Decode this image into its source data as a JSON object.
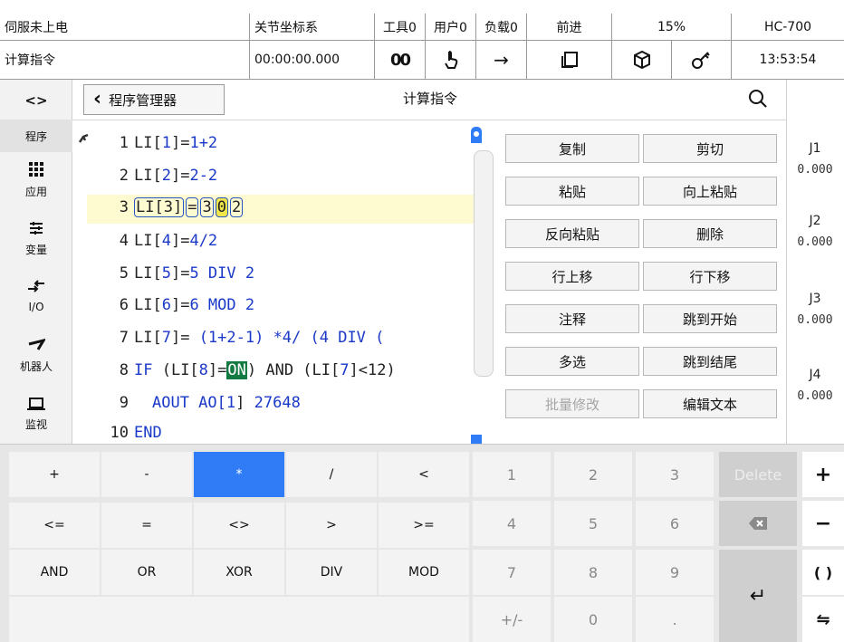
{
  "status": {
    "servo": "伺服未上电",
    "coord": "关节坐标系",
    "tool": "工具0",
    "user": "用户0",
    "load": "负载0",
    "direction": "前进",
    "speed": "15%",
    "model": "HC-700",
    "program_label": "计算指令",
    "elapsed": "00:00:00.000",
    "pause_icon_text": "00",
    "arrow_icon_text": "→",
    "clock": "13:53:54"
  },
  "header": {
    "back_label": "程序管理器",
    "back_chevron": "‹",
    "title": "计算指令"
  },
  "sidebar": {
    "toggle_glyph": "<>",
    "items": [
      {
        "label": "程序",
        "icon": "program-icon"
      },
      {
        "label": "应用",
        "icon": "apps-icon"
      },
      {
        "label": "变量",
        "icon": "variable-icon"
      },
      {
        "label": "I/O",
        "icon": "io-icon"
      },
      {
        "label": "机器人",
        "icon": "robot-icon"
      },
      {
        "label": "监视",
        "icon": "monitor-icon"
      }
    ]
  },
  "code": {
    "l1": {
      "num": "1",
      "a": "LI[",
      "b": "1",
      "c": "]=",
      "d": "1+2"
    },
    "l2": {
      "num": "2",
      "a": "LI[",
      "b": "2",
      "c": "]=",
      "d": "2-2"
    },
    "l3": {
      "num": "3",
      "var": "LI[3]",
      "eq": "=",
      "t1": "3",
      "t2": "0",
      "t3": "2"
    },
    "l4": {
      "num": "4",
      "a": "LI[",
      "b": "4",
      "c": "]=",
      "d": "4/2"
    },
    "l5": {
      "num": "5",
      "a": "LI[",
      "b": "5",
      "c": "]=",
      "d": "5 DIV 2"
    },
    "l6": {
      "num": "6",
      "a": "LI[",
      "b": "6",
      "c": "]=",
      "d": "6 MOD 2"
    },
    "l7": {
      "num": "7",
      "a": "LI[",
      "b": "7",
      "c": "]= ",
      "d": "(1+2-1) *4/ (4 DIV ("
    },
    "l8": {
      "num": "8",
      "a": "IF ",
      "b": "(LI[",
      "c": "8",
      "d": "]=",
      "e": "ON",
      "f": ") AND (LI[",
      "g": "7",
      "h": "]<12)"
    },
    "l9": {
      "num": "9",
      "a": "AOUT AO[",
      "b": "1",
      "c": "] ",
      "d": "27648"
    },
    "l10": {
      "num": "10",
      "a": "END"
    }
  },
  "menu": {
    "copy": "复制",
    "cut": "剪切",
    "paste": "粘贴",
    "paste_up": "向上粘贴",
    "reverse_paste": "反向粘贴",
    "delete": "删除",
    "move_up": "行上移",
    "move_down": "行下移",
    "comment": "注释",
    "jump_start": "跳到开始",
    "multi_select": "多选",
    "jump_end": "跳到结尾",
    "batch_edit": "批量修改",
    "edit_text": "编辑文本"
  },
  "joints": [
    {
      "name": "J1",
      "value": "0.000"
    },
    {
      "name": "J2",
      "value": "0.000"
    },
    {
      "name": "J3",
      "value": "0.000"
    },
    {
      "name": "J4",
      "value": "0.000"
    }
  ],
  "keyboard": {
    "ops": [
      "+",
      "-",
      "*",
      "/",
      "<",
      "<=",
      "=",
      "<>",
      ">",
      ">=",
      "AND",
      "OR",
      "XOR",
      "DIV",
      "MOD"
    ],
    "nums": [
      "1",
      "2",
      "3",
      "4",
      "5",
      "6",
      "7",
      "8",
      "9",
      "+/-",
      "0",
      "."
    ],
    "delete": "Delete",
    "backspace": "⌫",
    "enter": "↵",
    "side": [
      "+",
      "−",
      "( )",
      "⇋"
    ]
  },
  "colors": {
    "accent": "#2f7cf6",
    "key_gray": "#f3f3f3",
    "enter_gray": "#cfcfcf",
    "highlight_line": "#fffbd0",
    "on_green": "#147a43"
  }
}
